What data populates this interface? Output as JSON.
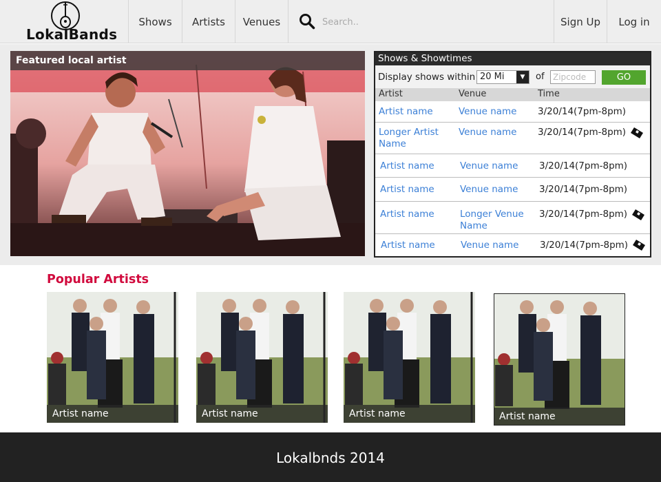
{
  "brand": {
    "name": "LokalBands"
  },
  "nav": {
    "shows": "Shows",
    "artists": "Artists",
    "venues": "Venues",
    "signup": "Sign Up",
    "login": "Log in"
  },
  "search": {
    "placeholder": "Search.."
  },
  "featured": {
    "label": "Featured local artist"
  },
  "shows_panel": {
    "title": "Shows & Showtimes",
    "filter_label": "Display shows within",
    "distance": "20 Mi",
    "of": "of",
    "zip_placeholder": "Zipcode",
    "go": "GO",
    "headers": {
      "artist": "Artist",
      "venue": "Venue",
      "time": "Time"
    },
    "rows": [
      {
        "artist": "Artist name",
        "venue": "Venue name",
        "time": "3/20/14(7pm-8pm)",
        "ticket": false
      },
      {
        "artist": "Longer Artist Name",
        "venue": "Venue name",
        "time": "3/20/14(7pm-8pm)",
        "ticket": true
      },
      {
        "artist": "Artist name",
        "venue": "Venue name",
        "time": "3/20/14(7pm-8pm)",
        "ticket": false
      },
      {
        "artist": "Artist name",
        "venue": "Venue name",
        "time": "3/20/14(7pm-8pm)",
        "ticket": false
      },
      {
        "artist": "Artist name",
        "venue": "Longer Venue Name",
        "time": "3/20/14(7pm-8pm)",
        "ticket": true
      },
      {
        "artist": "Artist name",
        "venue": "Venue name",
        "time": "3/20/14(7pm-8pm)",
        "ticket": true
      }
    ]
  },
  "popular": {
    "title": "Popular Artists",
    "cards": [
      {
        "label": "Artist name"
      },
      {
        "label": "Artist name"
      },
      {
        "label": "Artist name"
      },
      {
        "label": "Artist name"
      }
    ]
  },
  "footer": {
    "text": "Lokalbnds 2014"
  },
  "colors": {
    "accent_red": "#d10a3d",
    "link_blue": "#3b7fd6",
    "go_green": "#52a52e",
    "footer_bg": "#222222"
  }
}
